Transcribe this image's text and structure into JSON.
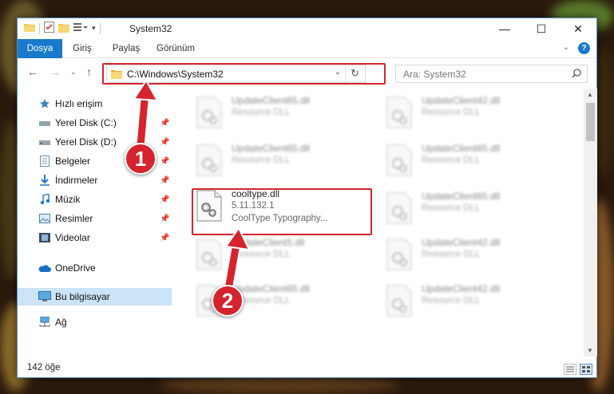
{
  "window": {
    "title": "System32",
    "controls": {
      "minimize": "—",
      "maximize": "☐",
      "close": "✕"
    }
  },
  "ribbon": {
    "tabs": [
      {
        "label": "Dosya",
        "active": true
      },
      {
        "label": "Giriş"
      },
      {
        "label": "Paylaş"
      },
      {
        "label": "Görünüm"
      }
    ],
    "help": "?"
  },
  "nav": {
    "address": "C:\\Windows\\System32",
    "search_placeholder": "Ara: System32"
  },
  "sidebar": {
    "items": [
      {
        "label": "Hızlı erişim",
        "icon": "star-icon",
        "pinned": false
      },
      {
        "label": "Yerel Disk (C:)",
        "icon": "drive-icon",
        "pinned": true
      },
      {
        "label": "Yerel Disk (D:)",
        "icon": "drive-icon",
        "pinned": true
      },
      {
        "label": "Belgeler",
        "icon": "document-icon",
        "pinned": true
      },
      {
        "label": "İndirmeler",
        "icon": "download-icon",
        "pinned": true
      },
      {
        "label": "Müzik",
        "icon": "music-icon",
        "pinned": true
      },
      {
        "label": "Resimler",
        "icon": "pictures-icon",
        "pinned": true
      },
      {
        "label": "Videolar",
        "icon": "video-icon",
        "pinned": true
      },
      {
        "label": "OneDrive",
        "icon": "cloud-icon",
        "pinned": false
      },
      {
        "label": "Bu bilgisayar",
        "icon": "computer-icon",
        "pinned": false,
        "selected": true
      },
      {
        "label": "Ağ",
        "icon": "network-icon",
        "pinned": false
      }
    ]
  },
  "files": {
    "left_column": [
      {
        "name": "UpdateClient65.dll",
        "type": "Resource DLL",
        "blurred": true
      },
      {
        "name": "UpdateClient65.dll",
        "type": "Resource DLL",
        "blurred": true
      },
      {
        "name": "cooltype.dll",
        "version": "5.11.132.1",
        "type": "CoolType Typography...",
        "blurred": false
      },
      {
        "name": "UpdateClient5.dll",
        "type": "Resource DLL",
        "blurred": true
      },
      {
        "name": "UpdateClient65.dll",
        "type": "Resource DLL",
        "blurred": true
      }
    ],
    "right_column": [
      {
        "name": "UpdateClient42.dll",
        "type": "Resource DLL",
        "blurred": true
      },
      {
        "name": "UpdateClient65.dll",
        "type": "Resource DLL",
        "blurred": true
      },
      {
        "name": "UpdateClient65.dll",
        "type": "Resource DLL",
        "blurred": true
      },
      {
        "name": "UpdateClient42.dll",
        "type": "Resource DLL",
        "blurred": true
      },
      {
        "name": "UpdateClient42.dll",
        "type": "Resource DLL",
        "blurred": true
      }
    ]
  },
  "status": {
    "item_count": "142 öğe"
  },
  "annotations": {
    "callout1": "1",
    "callout2": "2",
    "color": "#d5242d"
  }
}
